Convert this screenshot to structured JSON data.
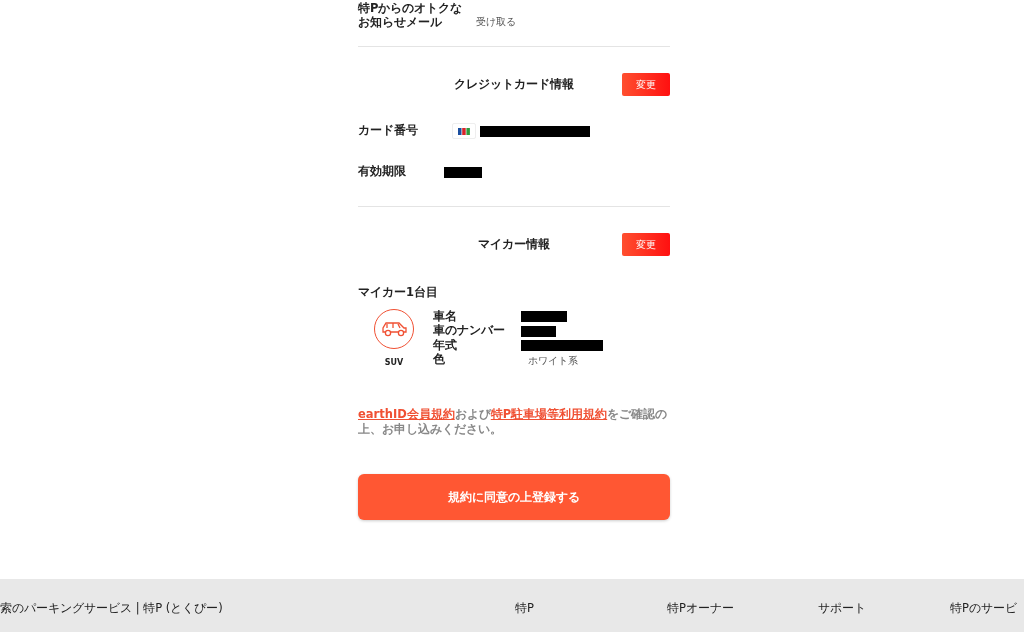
{
  "notification": {
    "label_lines": [
      "特Pからのオトクな",
      "お知らせメール"
    ],
    "value": "受け取る"
  },
  "credit_card": {
    "title": "クレジットカード情報",
    "change_button": "変更",
    "rows": [
      {
        "label": "カード番号",
        "kind": "card"
      },
      {
        "label": "有効期限",
        "kind": "redacted"
      }
    ]
  },
  "my_car": {
    "title": "マイカー情報",
    "change_button": "変更",
    "cars": [
      {
        "heading": "マイカー1台目",
        "type": "SUV",
        "fields": [
          {
            "label": "車名",
            "redacted": true
          },
          {
            "label": "車のナンバー",
            "redacted": true
          },
          {
            "label": "年式",
            "redacted": true
          },
          {
            "label": "色",
            "redacted": false,
            "value": "ホワイト系"
          }
        ]
      }
    ]
  },
  "terms": [
    {
      "text": "earthID会員規約",
      "link": true
    },
    {
      "text": "および",
      "link": false
    },
    {
      "text": "特P駐車場等利用規約",
      "link": true
    },
    {
      "text": "をご確認の上、お申し込みください。",
      "link": false
    }
  ],
  "submit_button": "規約に同意の上登録する",
  "footer": {
    "brand": "索のパーキングサービス | 特P (とくぴー)",
    "links": [
      "特P",
      "特Pオーナー",
      "サポート",
      "特Pのサービ"
    ]
  }
}
